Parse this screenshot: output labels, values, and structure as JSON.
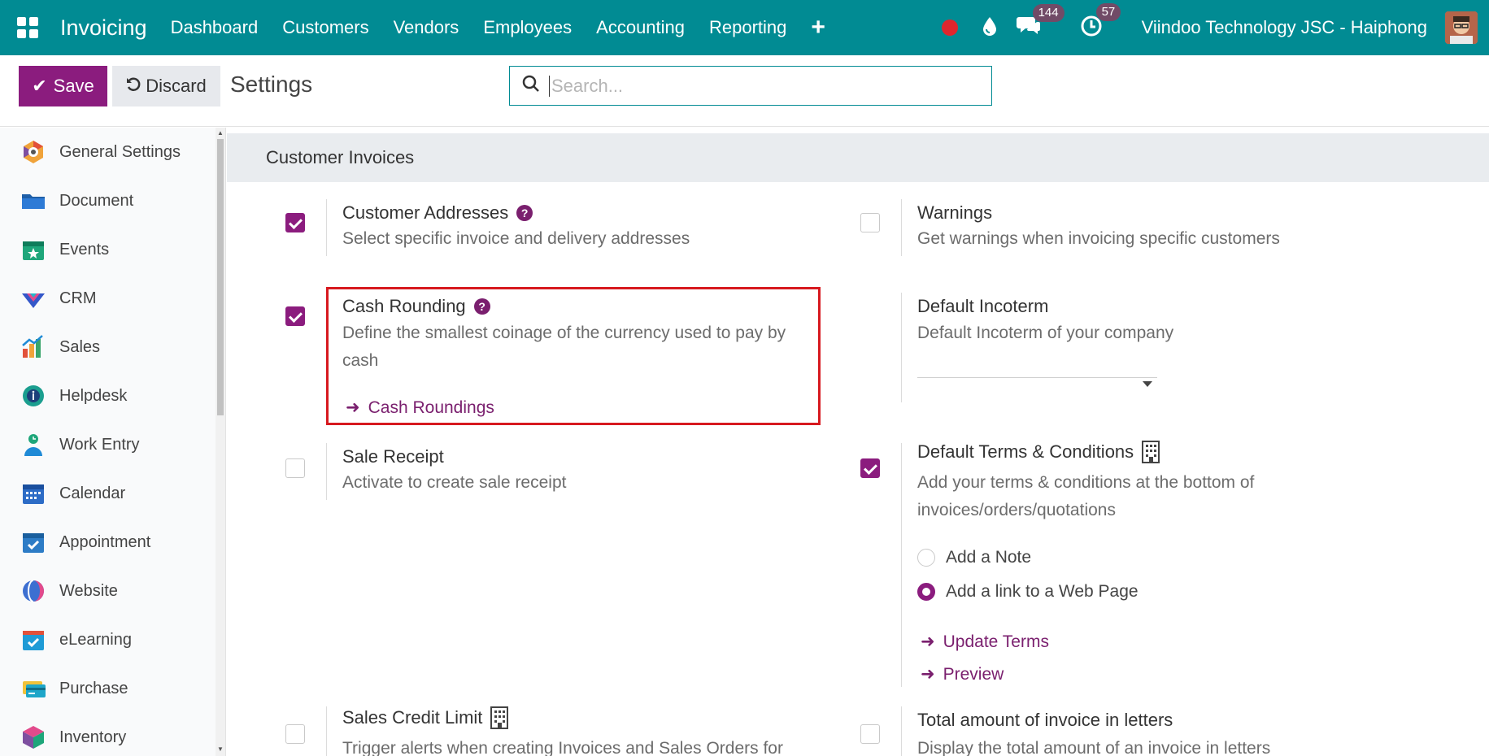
{
  "navbar": {
    "app_name": "Invoicing",
    "menu": [
      "Dashboard",
      "Customers",
      "Vendors",
      "Employees",
      "Accounting",
      "Reporting"
    ],
    "messages_count": "144",
    "activities_count": "57",
    "company": "Viindoo Technology JSC - Haiphong",
    "colors": {
      "bar": "#018b93",
      "badge": "#714b67",
      "record": "#e0262d"
    }
  },
  "control_panel": {
    "save_label": "Save",
    "discard_label": "Discard",
    "title": "Settings",
    "search_placeholder": "Search..."
  },
  "sidebar": {
    "items": [
      {
        "label": "General Settings",
        "icon": "general-settings-icon"
      },
      {
        "label": "Document",
        "icon": "folder-icon"
      },
      {
        "label": "Events",
        "icon": "events-icon"
      },
      {
        "label": "CRM",
        "icon": "crm-icon"
      },
      {
        "label": "Sales",
        "icon": "sales-chart-icon"
      },
      {
        "label": "Helpdesk",
        "icon": "helpdesk-icon"
      },
      {
        "label": "Work Entry",
        "icon": "work-entry-icon"
      },
      {
        "label": "Calendar",
        "icon": "calendar-icon"
      },
      {
        "label": "Appointment",
        "icon": "appointment-icon"
      },
      {
        "label": "Website",
        "icon": "website-icon"
      },
      {
        "label": "eLearning",
        "icon": "elearning-icon"
      },
      {
        "label": "Purchase",
        "icon": "purchase-icon"
      },
      {
        "label": "Inventory",
        "icon": "inventory-icon"
      }
    ]
  },
  "section": {
    "title": "Customer Invoices",
    "settings": {
      "customer_addresses": {
        "title": "Customer Addresses",
        "desc": "Select specific invoice and delivery addresses",
        "checked": true
      },
      "warnings": {
        "title": "Warnings",
        "desc": "Get warnings when invoicing specific customers",
        "checked": false
      },
      "cash_rounding": {
        "title": "Cash Rounding",
        "desc": "Define the smallest coinage of the currency used to pay by cash",
        "link": "Cash Roundings",
        "checked": true
      },
      "default_incoterm": {
        "title": "Default Incoterm",
        "desc": "Default Incoterm of your company",
        "value": ""
      },
      "sale_receipt": {
        "title": "Sale Receipt",
        "desc": "Activate to create sale receipt",
        "checked": false
      },
      "default_terms": {
        "title": "Default Terms & Conditions",
        "desc": "Add your terms & conditions at the bottom of invoices/orders/quotations",
        "checked": true,
        "options": [
          "Add a Note",
          "Add a link to a Web Page"
        ],
        "selected": "Add a link to a Web Page",
        "link_update": "Update Terms",
        "link_preview": "Preview"
      },
      "sales_credit_limit": {
        "title": "Sales Credit Limit",
        "desc": "Trigger alerts when creating Invoices and Sales Orders for",
        "checked": false
      },
      "amount_in_letters": {
        "title": "Total amount of invoice in letters",
        "desc": "Display the total amount of an invoice in letters",
        "checked": false
      }
    }
  },
  "accent_color": "#8b1c7e"
}
